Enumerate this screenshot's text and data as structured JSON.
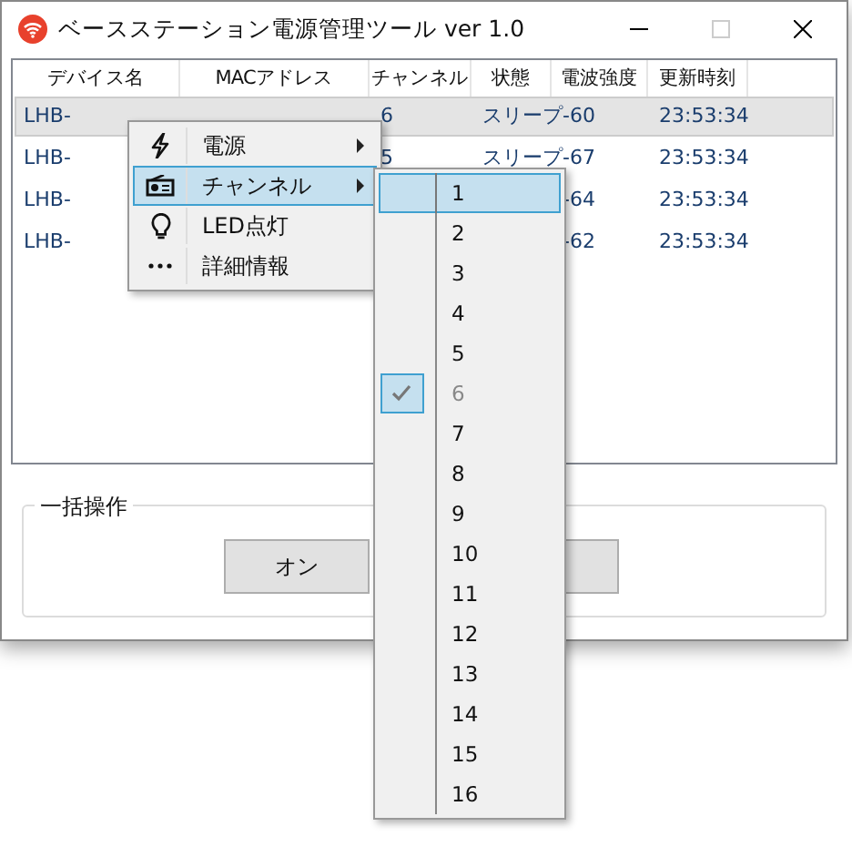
{
  "window": {
    "title": "ベースステーション電源管理ツール ver 1.0"
  },
  "table": {
    "columns": [
      "デバイス名",
      "MACアドレス",
      "チャンネル",
      "状態",
      "電波強度",
      "更新時刻"
    ],
    "rows": [
      {
        "selected": true,
        "cells": [
          "LHB-",
          "",
          "6",
          "スリープ",
          "-60",
          "23:53:34"
        ]
      },
      {
        "selected": false,
        "cells": [
          "LHB-",
          "",
          "5",
          "スリープ",
          "-67",
          "23:53:34"
        ]
      },
      {
        "selected": false,
        "cells": [
          "LHB-",
          "",
          "",
          "",
          "-64",
          "23:53:34"
        ]
      },
      {
        "selected": false,
        "cells": [
          "LHB-",
          "",
          "",
          "",
          "-62",
          "23:53:34"
        ]
      }
    ]
  },
  "context_menu": {
    "items": [
      {
        "kind": "power",
        "label": "電源",
        "submenu": true,
        "selected": false
      },
      {
        "kind": "radio",
        "label": "チャンネル",
        "submenu": true,
        "selected": true
      },
      {
        "kind": "bulb",
        "label": "LED点灯",
        "submenu": false,
        "selected": false
      },
      {
        "kind": "more",
        "label": "詳細情報",
        "submenu": false,
        "selected": false
      }
    ]
  },
  "channel_menu": {
    "items": [
      {
        "label": "1",
        "selected": true,
        "checked": false
      },
      {
        "label": "2",
        "selected": false,
        "checked": false
      },
      {
        "label": "3",
        "selected": false,
        "checked": false
      },
      {
        "label": "4",
        "selected": false,
        "checked": false
      },
      {
        "label": "5",
        "selected": false,
        "checked": false
      },
      {
        "label": "6",
        "selected": false,
        "checked": true
      },
      {
        "label": "7",
        "selected": false,
        "checked": false
      },
      {
        "label": "8",
        "selected": false,
        "checked": false
      },
      {
        "label": "9",
        "selected": false,
        "checked": false
      },
      {
        "label": "10",
        "selected": false,
        "checked": false
      },
      {
        "label": "11",
        "selected": false,
        "checked": false
      },
      {
        "label": "12",
        "selected": false,
        "checked": false
      },
      {
        "label": "13",
        "selected": false,
        "checked": false
      },
      {
        "label": "14",
        "selected": false,
        "checked": false
      },
      {
        "label": "15",
        "selected": false,
        "checked": false
      },
      {
        "label": "16",
        "selected": false,
        "checked": false
      }
    ]
  },
  "batch_group": {
    "title": "一括操作",
    "buttons": [
      "オン"
    ]
  }
}
